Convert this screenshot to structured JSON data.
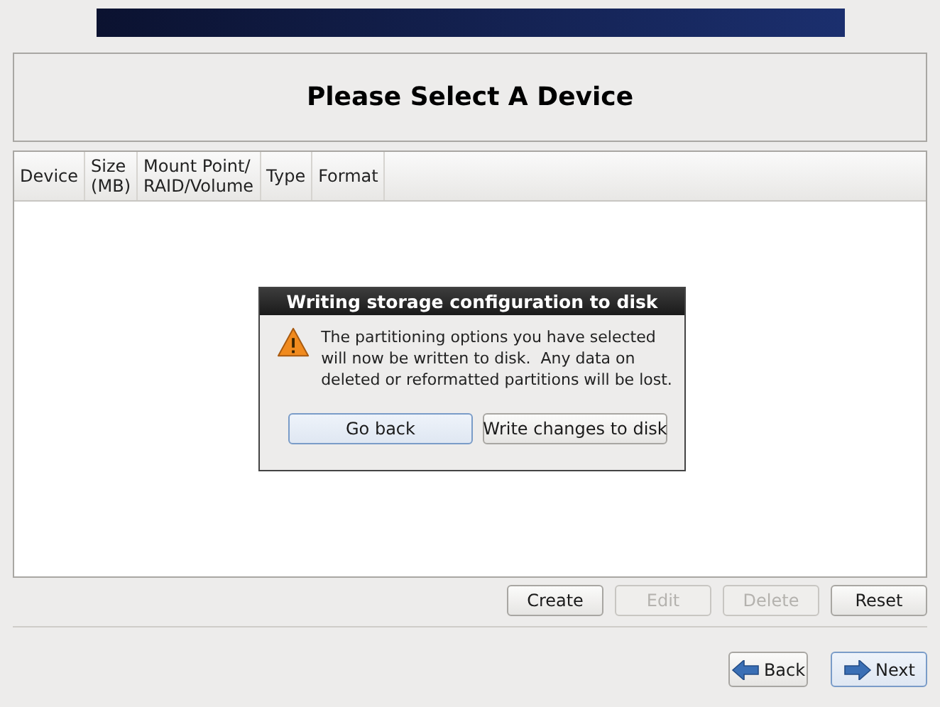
{
  "title": "Please Select A Device",
  "table": {
    "columns": [
      "Device",
      "Size\n(MB)",
      "Mount Point/\nRAID/Volume",
      "Type",
      "Format"
    ]
  },
  "actions": [
    {
      "label": "Create",
      "disabled": false
    },
    {
      "label": "Edit",
      "disabled": true
    },
    {
      "label": "Delete",
      "disabled": true
    },
    {
      "label": "Reset",
      "disabled": false
    }
  ],
  "navigation": [
    {
      "label": "Back",
      "kind": "back",
      "focused": false
    },
    {
      "label": "Next",
      "kind": "next",
      "focused": true
    }
  ],
  "dialog": {
    "title": "Writing storage configuration to disk",
    "message": "The partitioning options you have selected will now be written to disk.  Any data on deleted or reformatted partitions will be lost.",
    "buttons": [
      {
        "label": "Go back",
        "focused": true
      },
      {
        "label": "Write changes to disk",
        "focused": false
      }
    ]
  }
}
